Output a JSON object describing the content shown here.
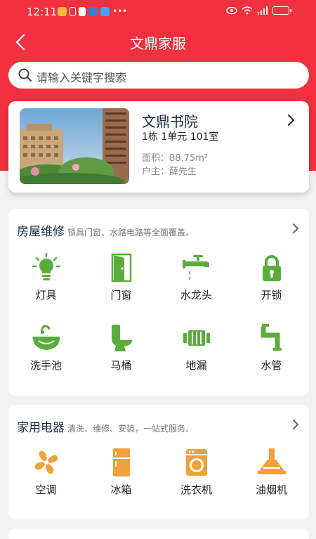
{
  "status_bar": {
    "time": "12:11"
  },
  "nav": {
    "title": "文鼎家服"
  },
  "search": {
    "placeholder": "请输入关键字搜索"
  },
  "house": {
    "name": "文鼎书院",
    "unit": "1栋 1单元 101室",
    "area": "面积：88.75m²",
    "owner": "户主：薛先生"
  },
  "repair": {
    "title": "房屋维修",
    "subtitle": "锁具门窗、水路电路等全面覆盖。",
    "items": [
      {
        "label": "灯具",
        "icon": "lightbulb-icon"
      },
      {
        "label": "门窗",
        "icon": "door-icon"
      },
      {
        "label": "水龙头",
        "icon": "faucet-icon"
      },
      {
        "label": "开锁",
        "icon": "lock-icon"
      },
      {
        "label": "洗手池",
        "icon": "sink-icon"
      },
      {
        "label": "马桶",
        "icon": "toilet-icon"
      },
      {
        "label": "地漏",
        "icon": "floor-drain-icon"
      },
      {
        "label": "水管",
        "icon": "water-pipe-icon"
      }
    ]
  },
  "appliances": {
    "title": "家用电器",
    "subtitle": "清洗、维修、安装，一站式服务。",
    "items": [
      {
        "label": "空调",
        "icon": "air-conditioner-icon"
      },
      {
        "label": "冰箱",
        "icon": "refrigerator-icon"
      },
      {
        "label": "洗衣机",
        "icon": "washing-machine-icon"
      },
      {
        "label": "油烟机",
        "icon": "range-hood-icon"
      }
    ]
  },
  "colors": {
    "brand_red": "#f23040",
    "repair_green": "#5aad3c",
    "appliance_orange": "#f2a03c"
  }
}
